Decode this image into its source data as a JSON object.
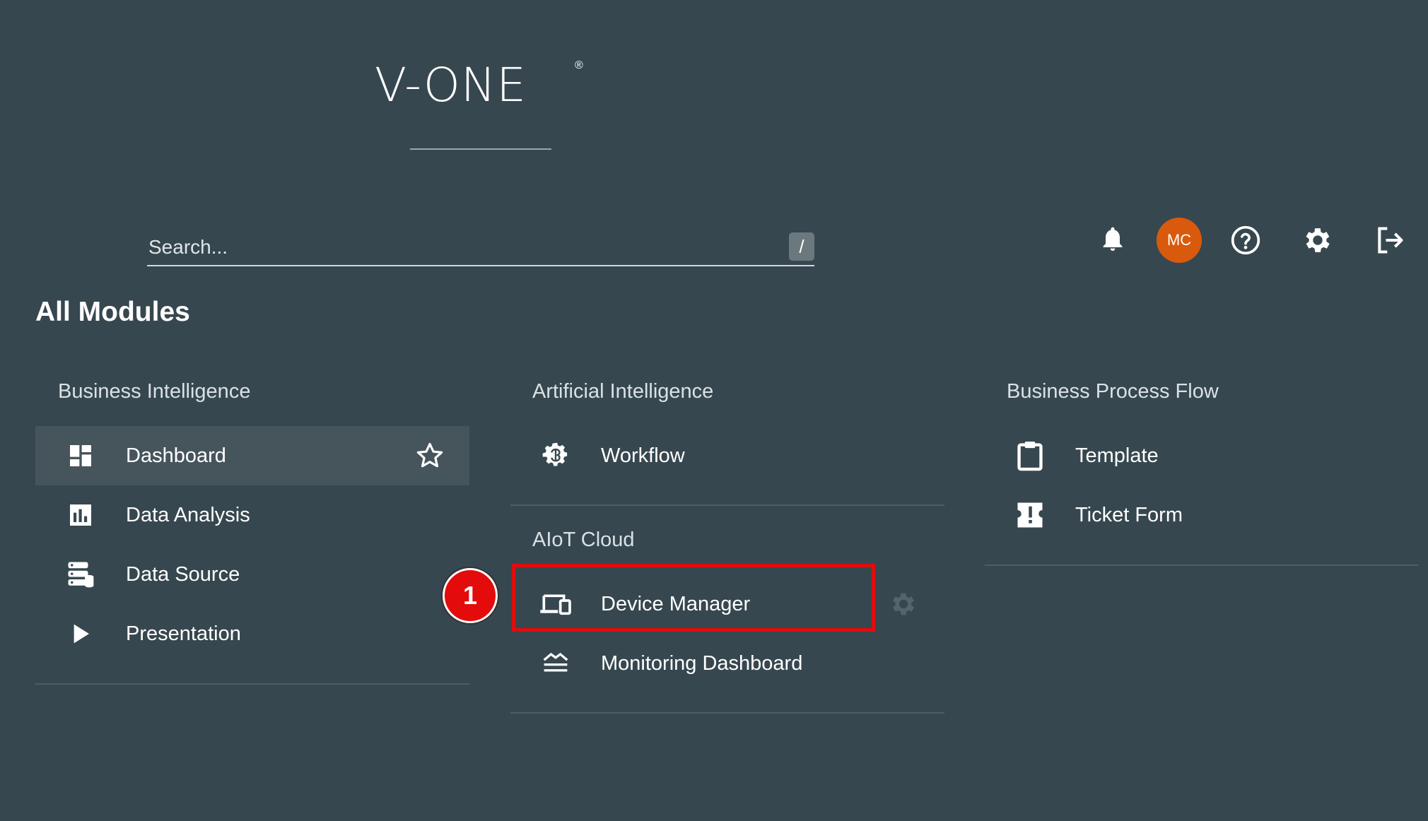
{
  "logo": {
    "text": "V-ONE",
    "registered": "®"
  },
  "search": {
    "placeholder": "Search...",
    "shortcut": "/"
  },
  "toolbar": {
    "notifications_icon": "bell-icon",
    "avatar_initials": "MC",
    "avatar_color": "#d95a0c",
    "help_icon": "help-circle-icon",
    "settings_icon": "gear-icon",
    "logout_icon": "logout-icon"
  },
  "page_title": "All Modules",
  "groups": {
    "business_intelligence": {
      "title": "Business Intelligence",
      "items": [
        {
          "label": "Dashboard",
          "icon": "dashboard-icon",
          "favorite_icon": "star-outline-icon"
        },
        {
          "label": "Data Analysis",
          "icon": "bar-chart-icon"
        },
        {
          "label": "Data Source",
          "icon": "database-icon"
        },
        {
          "label": "Presentation",
          "icon": "play-icon"
        }
      ]
    },
    "artificial_intelligence": {
      "title": "Artificial Intelligence",
      "items": [
        {
          "label": "Workflow",
          "icon": "brain-gear-icon"
        }
      ]
    },
    "aiot_cloud": {
      "title": "AIoT Cloud",
      "items": [
        {
          "label": "Device Manager",
          "icon": "devices-icon",
          "settings_icon": "gear-icon"
        },
        {
          "label": "Monitoring Dashboard",
          "icon": "monitoring-icon"
        }
      ]
    },
    "business_process_flow": {
      "title": "Business Process Flow",
      "items": [
        {
          "label": "Template",
          "icon": "clipboard-icon"
        },
        {
          "label": "Ticket Form",
          "icon": "alert-ticket-icon"
        }
      ]
    }
  },
  "annotation": {
    "number": "1",
    "color": "#e10d0d"
  }
}
